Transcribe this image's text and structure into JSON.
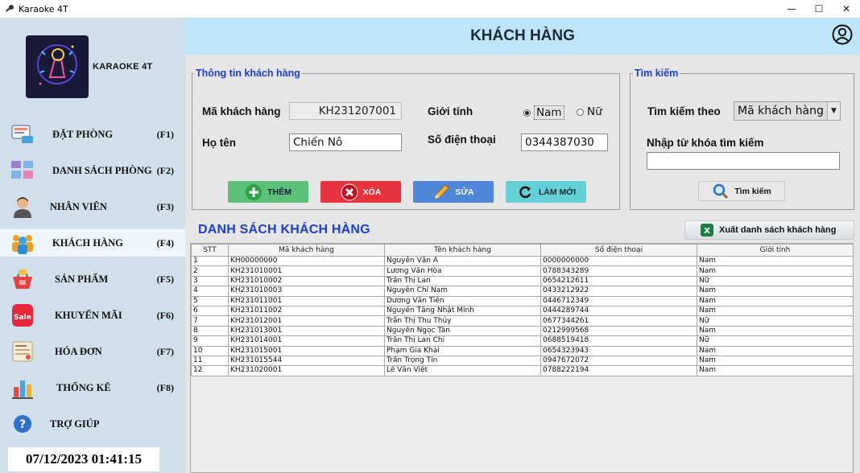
{
  "window": {
    "title": "Karaoke 4T",
    "minimize": "—",
    "maximize": "☐",
    "close": "✕"
  },
  "brand": {
    "name": "KARAOKE 4T"
  },
  "nav": [
    {
      "label": "ĐẶT PHÒNG",
      "key": "(F1)"
    },
    {
      "label": "DANH SÁCH PHÒNG",
      "key": "(F2)"
    },
    {
      "label": "NHÂN VIÊN",
      "key": "(F3)"
    },
    {
      "label": "KHÁCH HÀNG",
      "key": "(F4)"
    },
    {
      "label": "SẢN PHẨM",
      "key": "(F5)"
    },
    {
      "label": "KHUYẾN MÃI",
      "key": "(F6)"
    },
    {
      "label": "HÓA ĐƠN",
      "key": "(F7)"
    },
    {
      "label": "THỐNG KÊ",
      "key": "(F8)"
    },
    {
      "label": "TRỢ GIÚP",
      "key": ""
    }
  ],
  "clock": "07/12/2023 01:41:15",
  "header": {
    "title": "KHÁCH HÀNG"
  },
  "info": {
    "title": "Thông tin khách hàng",
    "code_label": "Mã khách hàng",
    "code_value": "KH231207001",
    "gender_label": "Giới tính",
    "gender_male": "Nam",
    "gender_female": "Nữ",
    "gender_selected": "Nam",
    "name_label": "Họ tên",
    "name_value": "Chiến Nô",
    "phone_label": "Số điện thoại",
    "phone_value": "0344387030"
  },
  "actions": {
    "add": "THÊM",
    "delete": "XÓA",
    "edit": "SỬA",
    "reset": "LÀM MỚI"
  },
  "search": {
    "title": "Tìm kiếm",
    "by_label": "Tìm kiếm theo",
    "by_value": "Mã khách hàng",
    "keyword_label": "Nhập từ khóa tìm kiếm",
    "keyword_value": "",
    "button": "Tìm kiếm"
  },
  "list": {
    "title": "DANH SÁCH KHÁCH HÀNG",
    "export": "Xuất danh sách khách hàng"
  },
  "table": {
    "columns": [
      "STT",
      "Mã khách hàng",
      "Tên khách hàng",
      "Số điện thoại",
      "Giới tính"
    ],
    "rows": [
      [
        "1",
        "KH00000000",
        "Nguyễn Văn A",
        "0000000000",
        "Nam"
      ],
      [
        "2",
        "KH231010001",
        "Lương Văn Hòa",
        "0788343289",
        "Nam"
      ],
      [
        "3",
        "KH231010002",
        "Trần Thị Lan",
        "0654212611",
        "Nữ"
      ],
      [
        "4",
        "KH231010003",
        "Nguyễn Chí Nam",
        "0433212922",
        "Nam"
      ],
      [
        "5",
        "KH231011001",
        "Dương Văn Tiến",
        "0446712349",
        "Nam"
      ],
      [
        "6",
        "KH231011002",
        "Nguyễn Tăng Nhật Minh",
        "0444289744",
        "Nam"
      ],
      [
        "7",
        "KH231012001",
        "Trần Thị Thu Thủy",
        "0677344261",
        "Nữ"
      ],
      [
        "8",
        "KH231013001",
        "Nguyễn Ngọc Tân",
        "0212999568",
        "Nam"
      ],
      [
        "9",
        "KH231014001",
        "Trần Thị Lan Chi",
        "0688519418",
        "Nữ"
      ],
      [
        "10",
        "KH231015001",
        "Phạm Gia Khải",
        "0654323943",
        "Nam"
      ],
      [
        "11",
        "KH231015544",
        "Trần Trọng Tín",
        "0947672072",
        "Nam"
      ],
      [
        "12",
        "KH231020001",
        "Lê Văn Việt",
        "0788222194",
        "Nam"
      ]
    ]
  }
}
